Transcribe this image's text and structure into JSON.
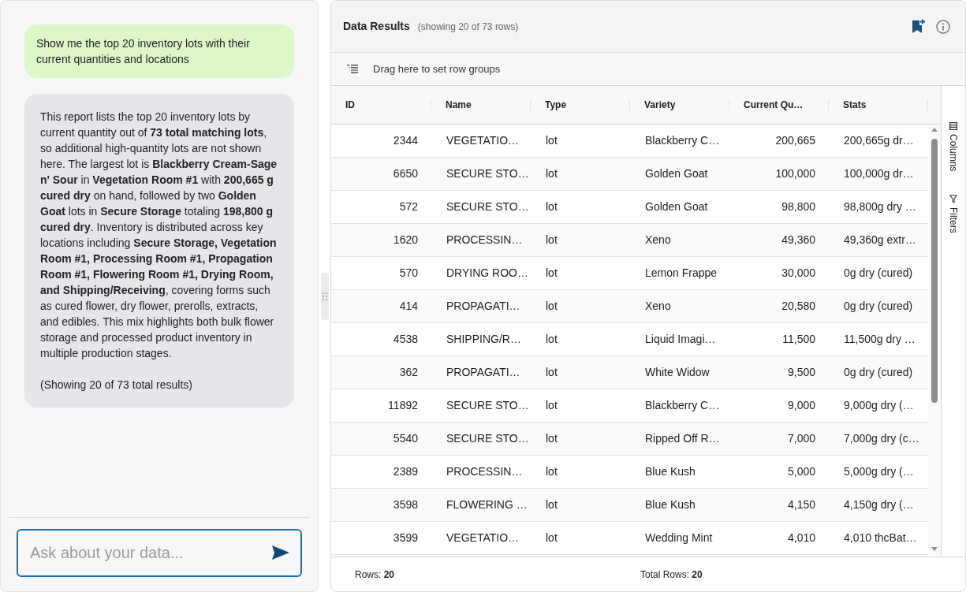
{
  "chat": {
    "messages": [
      {
        "kind": "user",
        "paragraphs": [
          "Show me the top 20 inventory lots with their current quantities and locations"
        ]
      },
      {
        "kind": "assistant",
        "paragraphs": [
          "This report lists the top 20 inventory lots by current quantity out of **73 total matching lots**, so additional high-quantity lots are not shown here. The largest lot is **Blackberry Cream-Sage n' Sour** in **Vegetation Room #1** with **200,665 g cured dry** on hand, followed by two **Golden Goat** lots in **Secure Storage** totaling **198,800 g cured dry**. Inventory is distributed across key locations including **Secure Storage, Vegetation Room #1, Processing Room #1, Propagation Room #1, Flowering Room #1, Drying Room, and Shipping/Receiving**, covering forms such as cured flower, dry flower, prerolls, extracts, and edibles. This mix highlights both bulk flower storage and processed product inventory in multiple production stages.",
          "(Showing 20 of 73 total results)"
        ]
      }
    ],
    "input": {
      "placeholder": "Ask about your data..."
    }
  },
  "results": {
    "title": "Data Results",
    "subtitle": "(showing 20 of 73 rows)",
    "row_group_hint": "Drag here to set row groups",
    "table": {
      "columns": [
        {
          "label": "ID",
          "kind": "number"
        },
        {
          "label": "Name",
          "kind": "text"
        },
        {
          "label": "Type",
          "kind": "text"
        },
        {
          "label": "Variety",
          "kind": "text"
        },
        {
          "label": "Current Qu…",
          "kind": "number"
        },
        {
          "label": "Stats",
          "kind": "text"
        }
      ],
      "rows": [
        [
          "2344",
          "VEGETATIO…",
          "lot",
          "Blackberry C…",
          "200,665",
          "200,665g dr…"
        ],
        [
          "6650",
          "SECURE STO…",
          "lot",
          "Golden Goat",
          "100,000",
          "100,000g dr…"
        ],
        [
          "572",
          "SECURE STO…",
          "lot",
          "Golden Goat",
          "98,800",
          "98,800g dry …"
        ],
        [
          "1620",
          "PROCESSIN…",
          "lot",
          "Xeno",
          "49,360",
          "49,360g extr…"
        ],
        [
          "570",
          "DRYING ROO…",
          "lot",
          "Lemon Frappe",
          "30,000",
          "0g dry (cured)"
        ],
        [
          "414",
          "PROPAGATI…",
          "lot",
          "Xeno",
          "20,580",
          "0g dry (cured)"
        ],
        [
          "4538",
          "SHIPPING/R…",
          "lot",
          "Liquid Imagi…",
          "11,500",
          "11,500g dry …"
        ],
        [
          "362",
          "PROPAGATI…",
          "lot",
          "White Widow",
          "9,500",
          "0g dry (cured)"
        ],
        [
          "11892",
          "SECURE STO…",
          "lot",
          "Blackberry C…",
          "9,000",
          "9,000g dry (…"
        ],
        [
          "5540",
          "SECURE STO…",
          "lot",
          "Ripped Off R…",
          "7,000",
          "7,000g dry (c…"
        ],
        [
          "2389",
          "PROCESSIN…",
          "lot",
          "Blue Kush",
          "5,000",
          "5,000g dry (…"
        ],
        [
          "3598",
          "FLOWERING …",
          "lot",
          "Blue Kush",
          "4,150",
          "4,150g dry (…"
        ],
        [
          "3599",
          "VEGETATIO…",
          "lot",
          "Wedding Mint",
          "4,010",
          "4,010 thcBat…"
        ]
      ]
    },
    "side_tabs": [
      {
        "label": "Columns",
        "kind": "columns"
      },
      {
        "label": "Filters",
        "kind": "filters"
      }
    ],
    "footer": [
      "Rows: **20**",
      "Total Rows: **20**"
    ]
  }
}
